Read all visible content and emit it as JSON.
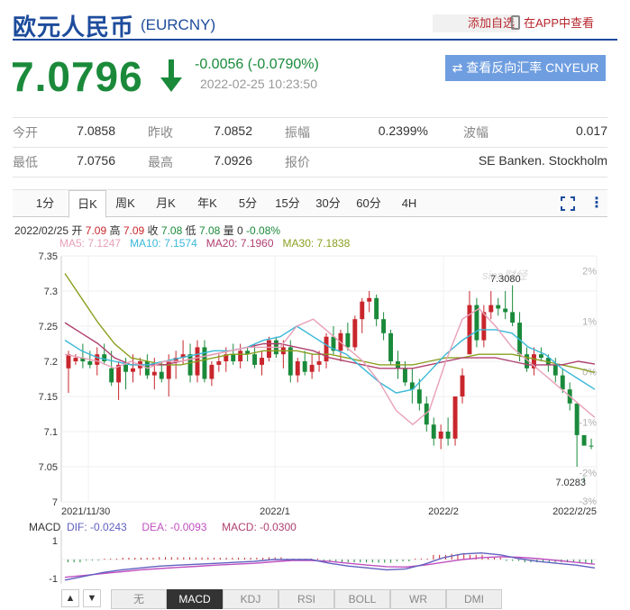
{
  "header": {
    "title": "欧元人民币",
    "code": "(EURCNY)",
    "watch_label": "添加自选",
    "app_label": "在APP中查看"
  },
  "quote": {
    "price": "7.0796",
    "change": "-0.0056 (-0.0790%)",
    "timestamp": "2022-02-25 10:23:50",
    "reverse_button": "⇄ 查看反向汇率 CNYEUR"
  },
  "stats": [
    [
      {
        "label": "今开",
        "value": "7.0858"
      },
      {
        "label": "昨收",
        "value": "7.0852"
      },
      {
        "label": "振幅",
        "value": "0.2399%"
      },
      {
        "label": "波幅",
        "value": "0.017"
      }
    ],
    [
      {
        "label": "最低",
        "value": "7.0756"
      },
      {
        "label": "最高",
        "value": "7.0926"
      },
      {
        "label": "报价",
        "value": ""
      },
      {
        "label": "",
        "value": "SE Banken. Stockholm"
      }
    ]
  ],
  "tabs": [
    "1分",
    "日K",
    "周K",
    "月K",
    "年K",
    "5分",
    "15分",
    "30分",
    "60分",
    "4H"
  ],
  "active_tab": "日K",
  "ohlc_info": {
    "date": "2022/02/25",
    "open_label": "开",
    "open": "7.09",
    "high_label": "高",
    "high": "7.09",
    "close_label": "收",
    "close": "7.08",
    "low_label": "低",
    "low": "7.08",
    "vol_label": "量",
    "vol": "0",
    "pct": "-0.08%"
  },
  "ma_info": {
    "ma5": "MA5: 7.1247",
    "ma10": "MA10: 7.1574",
    "ma20": "MA20: 7.1960",
    "ma30": "MA30: 7.1838"
  },
  "macd_info": {
    "label": "MACD",
    "dif": "DIF: -0.0243",
    "dea": "DEA: -0.0093",
    "macd": "MACD: -0.0300"
  },
  "indicator_nav": {
    "up": "▲",
    "down": "▼"
  },
  "indicators": [
    "无",
    "MACD",
    "KDJ",
    "RSI",
    "BOLL",
    "WR",
    "DMI"
  ],
  "active_indicator": "MACD",
  "colors": {
    "up": "#c8262c",
    "down": "#1a8a3a",
    "ma5": "#e8a0b8",
    "ma10": "#3ab8d8",
    "ma20": "#b04070",
    "ma30": "#8aa020",
    "dif": "#6060c0",
    "dea": "#c050c0",
    "brand": "#1d4c9c"
  },
  "chart_data": {
    "type": "candlestick",
    "ylim": [
      7.0,
      7.35
    ],
    "y_ticks": [
      "7.35",
      "7.3",
      "7.25",
      "7.2",
      "7.15",
      "7.1",
      "7.05",
      "7"
    ],
    "pct_ticks": [
      "2%",
      "1%",
      "0%",
      "-1%",
      "-2%",
      "-3%"
    ],
    "x_labels": [
      "2021/11/30",
      "2022/1",
      "2022/2",
      "2022/2/25"
    ],
    "annotations": {
      "max": "7.3080",
      "min": "7.0283"
    },
    "watermark": "sina财经",
    "macd_ticks": [
      "1",
      "-1"
    ],
    "candles": [
      [
        7.19,
        7.215,
        7.155,
        7.21
      ],
      [
        7.2,
        7.21,
        7.195,
        7.205
      ],
      [
        7.205,
        7.225,
        7.19,
        7.2
      ],
      [
        7.2,
        7.215,
        7.19,
        7.195
      ],
      [
        7.195,
        7.22,
        7.18,
        7.21
      ],
      [
        7.21,
        7.225,
        7.195,
        7.2
      ],
      [
        7.19,
        7.215,
        7.165,
        7.17
      ],
      [
        7.17,
        7.2,
        7.145,
        7.195
      ],
      [
        7.195,
        7.205,
        7.16,
        7.185
      ],
      [
        7.185,
        7.21,
        7.17,
        7.19
      ],
      [
        7.19,
        7.205,
        7.18,
        7.2
      ],
      [
        7.2,
        7.21,
        7.175,
        7.18
      ],
      [
        7.18,
        7.205,
        7.16,
        7.185
      ],
      [
        7.185,
        7.2,
        7.17,
        7.175
      ],
      [
        7.175,
        7.21,
        7.15,
        7.2
      ],
      [
        7.2,
        7.215,
        7.175,
        7.205
      ],
      [
        7.205,
        7.23,
        7.195,
        7.21
      ],
      [
        7.21,
        7.225,
        7.17,
        7.18
      ],
      [
        7.18,
        7.23,
        7.17,
        7.22
      ],
      [
        7.22,
        7.23,
        7.17,
        7.175
      ],
      [
        7.175,
        7.2,
        7.165,
        7.195
      ],
      [
        7.195,
        7.21,
        7.185,
        7.2
      ],
      [
        7.2,
        7.22,
        7.185,
        7.21
      ],
      [
        7.21,
        7.225,
        7.195,
        7.2
      ],
      [
        7.2,
        7.225,
        7.19,
        7.215
      ],
      [
        7.215,
        7.22,
        7.2,
        7.21
      ],
      [
        7.21,
        7.225,
        7.19,
        7.195
      ],
      [
        7.195,
        7.215,
        7.18,
        7.205
      ],
      [
        7.205,
        7.235,
        7.2,
        7.23
      ],
      [
        7.23,
        7.235,
        7.205,
        7.21
      ],
      [
        7.21,
        7.23,
        7.19,
        7.22
      ],
      [
        7.22,
        7.23,
        7.17,
        7.18
      ],
      [
        7.18,
        7.205,
        7.17,
        7.2
      ],
      [
        7.2,
        7.215,
        7.18,
        7.185
      ],
      [
        7.185,
        7.21,
        7.175,
        7.195
      ],
      [
        7.195,
        7.215,
        7.185,
        7.2
      ],
      [
        7.2,
        7.24,
        7.19,
        7.235
      ],
      [
        7.235,
        7.25,
        7.21,
        7.215
      ],
      [
        7.215,
        7.245,
        7.2,
        7.24
      ],
      [
        7.24,
        7.255,
        7.215,
        7.22
      ],
      [
        7.22,
        7.265,
        7.215,
        7.26
      ],
      [
        7.26,
        7.29,
        7.24,
        7.285
      ],
      [
        7.285,
        7.3,
        7.27,
        7.29
      ],
      [
        7.29,
        7.295,
        7.25,
        7.26
      ],
      [
        7.26,
        7.27,
        7.23,
        7.24
      ],
      [
        7.24,
        7.245,
        7.195,
        7.2
      ],
      [
        7.2,
        7.215,
        7.175,
        7.19
      ],
      [
        7.19,
        7.2,
        7.165,
        7.17
      ],
      [
        7.17,
        7.19,
        7.14,
        7.16
      ],
      [
        7.16,
        7.175,
        7.13,
        7.14
      ],
      [
        7.14,
        7.15,
        7.1,
        7.11
      ],
      [
        7.11,
        7.12,
        7.08,
        7.09
      ],
      [
        7.09,
        7.11,
        7.075,
        7.1
      ],
      [
        7.1,
        7.12,
        7.08,
        7.09
      ],
      [
        7.09,
        7.12,
        7.08,
        7.15
      ],
      [
        7.15,
        7.19,
        7.14,
        7.18
      ],
      [
        7.21,
        7.3,
        7.21,
        7.28
      ],
      [
        7.28,
        7.29,
        7.22,
        7.23
      ],
      [
        7.23,
        7.28,
        7.22,
        7.27
      ],
      [
        7.27,
        7.3,
        7.26,
        7.28
      ],
      [
        7.28,
        7.29,
        7.265,
        7.275
      ],
      [
        7.275,
        7.3,
        7.26,
        7.27
      ],
      [
        7.27,
        7.308,
        7.25,
        7.255
      ],
      [
        7.255,
        7.27,
        7.2,
        7.21
      ],
      [
        7.21,
        7.22,
        7.185,
        7.19
      ],
      [
        7.19,
        7.22,
        7.18,
        7.21
      ],
      [
        7.21,
        7.22,
        7.2,
        7.205
      ],
      [
        7.205,
        7.21,
        7.185,
        7.195
      ],
      [
        7.195,
        7.205,
        7.17,
        7.18
      ],
      [
        7.18,
        7.19,
        7.155,
        7.16
      ],
      [
        7.16,
        7.17,
        7.13,
        7.14
      ],
      [
        7.14,
        7.14,
        7.05,
        7.095
      ],
      [
        7.095,
        7.035,
        7.0283,
        7.08
      ],
      [
        7.08,
        7.09,
        7.075,
        7.0796
      ]
    ],
    "ma5": [
      7.21,
      7.205,
      7.2,
      7.19,
      7.2,
      7.19,
      7.2,
      7.2,
      7.205,
      7.21,
      7.215,
      7.22,
      7.22,
      7.22,
      7.25,
      7.26,
      7.24,
      7.22,
      7.2,
      7.17,
      7.13,
      7.11,
      7.13,
      7.2,
      7.26,
      7.275,
      7.25,
      7.22,
      7.2,
      7.18,
      7.16,
      7.14,
      7.12
    ],
    "ma10": [
      7.23,
      7.215,
      7.205,
      7.2,
      7.195,
      7.195,
      7.2,
      7.205,
      7.21,
      7.215,
      7.215,
      7.22,
      7.23,
      7.235,
      7.25,
      7.235,
      7.22,
      7.21,
      7.19,
      7.17,
      7.155,
      7.16,
      7.185,
      7.21,
      7.23,
      7.245,
      7.245,
      7.24,
      7.22,
      7.21,
      7.19,
      7.175,
      7.16
    ],
    "ma20": [
      7.255,
      7.24,
      7.225,
      7.205,
      7.195,
      7.195,
      7.195,
      7.2,
      7.205,
      7.21,
      7.215,
      7.22,
      7.225,
      7.225,
      7.22,
      7.215,
      7.205,
      7.2,
      7.195,
      7.19,
      7.19,
      7.19,
      7.195,
      7.2,
      7.205,
      7.205,
      7.205,
      7.2,
      7.195,
      7.195,
      7.195,
      7.2,
      7.196
    ],
    "ma30": [
      7.325,
      7.29,
      7.255,
      7.225,
      7.205,
      7.2,
      7.195,
      7.195,
      7.2,
      7.205,
      7.21,
      7.21,
      7.215,
      7.215,
      7.215,
      7.21,
      7.21,
      7.205,
      7.2,
      7.195,
      7.195,
      7.195,
      7.2,
      7.205,
      7.205,
      7.21,
      7.21,
      7.21,
      7.205,
      7.2,
      7.195,
      7.19,
      7.184
    ],
    "macd_dif": [
      -1.1,
      -0.9,
      -0.7,
      -0.55,
      -0.45,
      -0.35,
      -0.3,
      -0.25,
      -0.2,
      -0.15,
      -0.1,
      0.0,
      0.0,
      0.0,
      -0.2,
      -0.35,
      -0.45,
      -0.55,
      -0.5,
      -0.25,
      0.1,
      0.3,
      0.35,
      0.25,
      0.05,
      -0.1,
      -0.2,
      -0.3,
      -0.45
    ],
    "macd_dea": [
      -0.95,
      -0.85,
      -0.75,
      -0.65,
      -0.55,
      -0.48,
      -0.42,
      -0.36,
      -0.3,
      -0.25,
      -0.2,
      -0.12,
      -0.05,
      -0.05,
      -0.1,
      -0.2,
      -0.3,
      -0.38,
      -0.4,
      -0.3,
      -0.15,
      0.0,
      0.1,
      0.15,
      0.12,
      0.05,
      -0.05,
      -0.15,
      -0.25
    ],
    "macd_hist": [
      -0.15,
      -0.05,
      0.05,
      0.1,
      0.1,
      0.13,
      0.12,
      0.11,
      0.1,
      0.1,
      0.1,
      0.12,
      0.05,
      0.05,
      -0.1,
      -0.15,
      -0.15,
      -0.17,
      -0.1,
      0.05,
      0.25,
      0.3,
      0.25,
      0.1,
      -0.07,
      -0.15,
      -0.15,
      -0.15,
      -0.2
    ]
  }
}
